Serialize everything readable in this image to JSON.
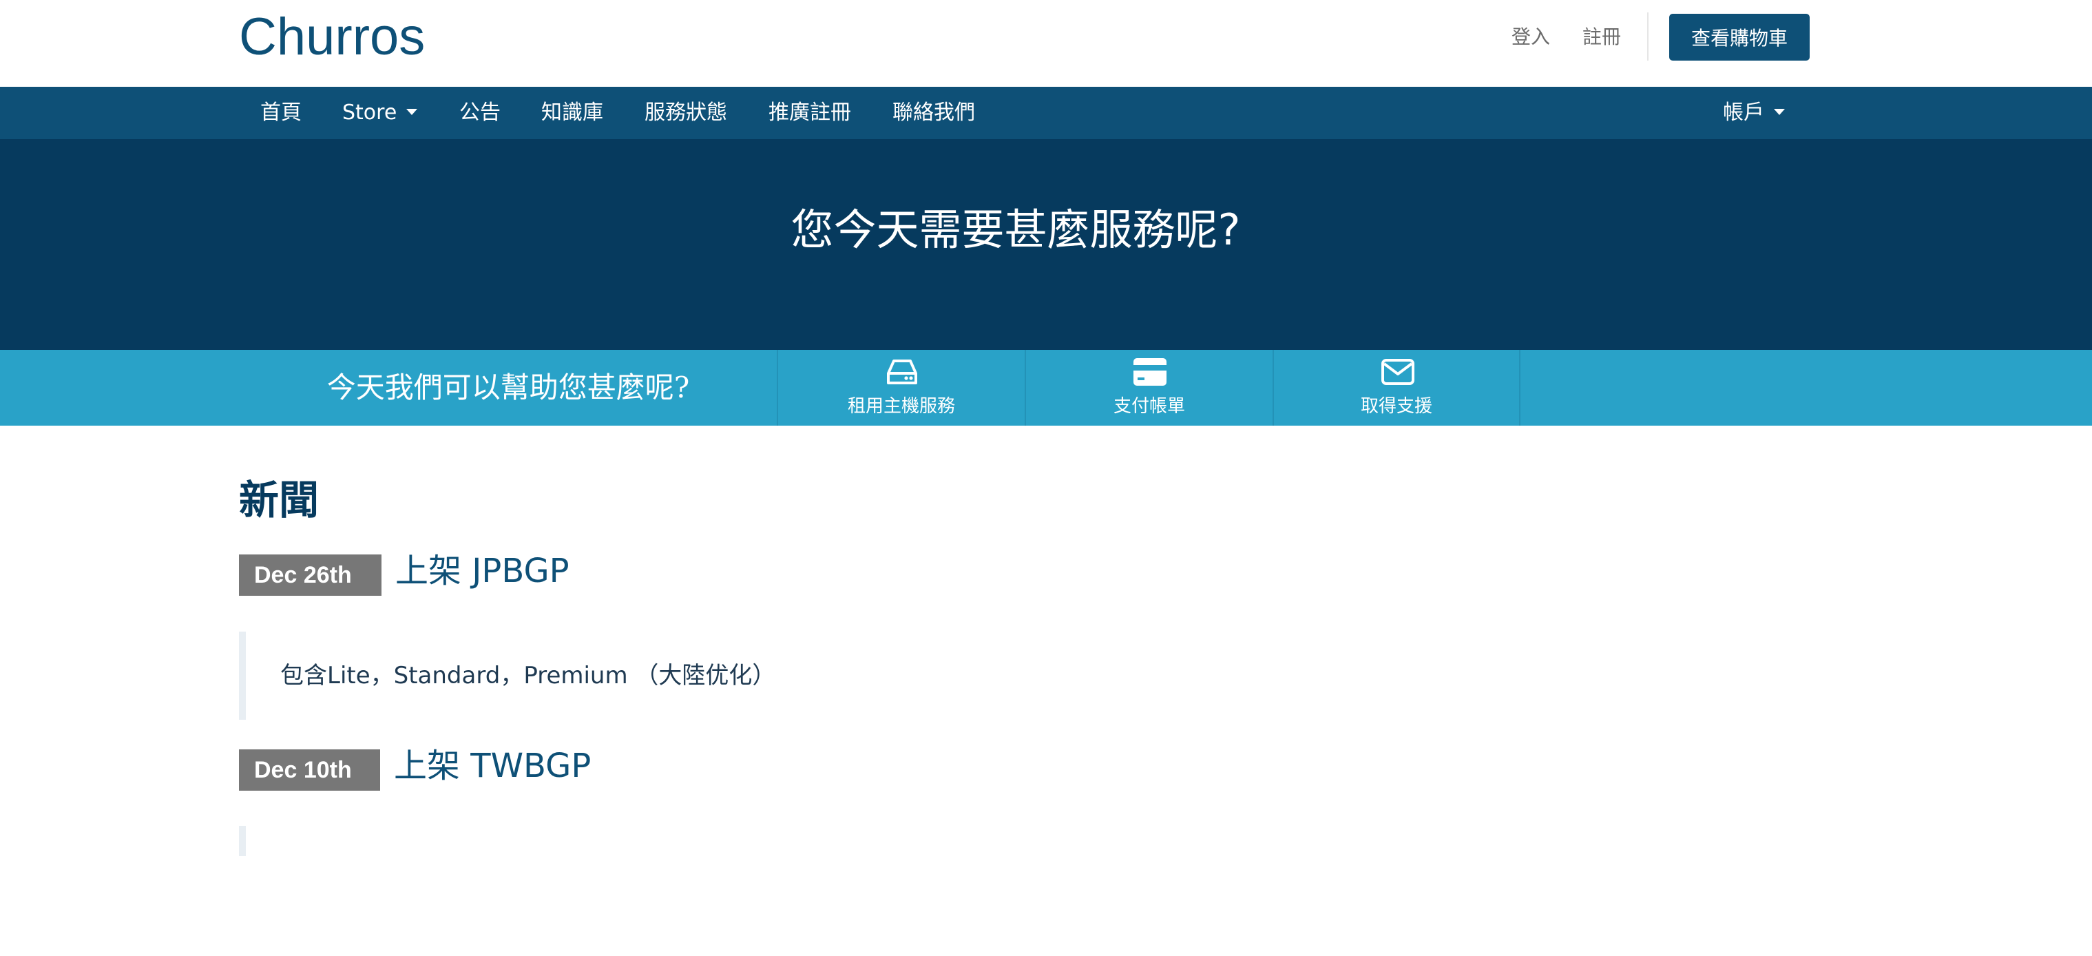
{
  "header": {
    "logo": "Churros",
    "login": "登入",
    "register": "註冊",
    "cart_button": "查看購物車"
  },
  "nav": {
    "items": [
      {
        "label": "首頁"
      },
      {
        "label": "Store"
      },
      {
        "label": "公告"
      },
      {
        "label": "知識庫"
      },
      {
        "label": "服務狀態"
      },
      {
        "label": "推廣註冊"
      },
      {
        "label": "聯絡我們"
      }
    ],
    "account": "帳戶"
  },
  "hero": {
    "title": "您今天需要甚麼服務呢?"
  },
  "help": {
    "text": "今天我們可以幫助您甚麼呢?",
    "items": [
      {
        "label": "租用主機服務",
        "icon": "server-icon"
      },
      {
        "label": "支付帳單",
        "icon": "credit-card-icon"
      },
      {
        "label": "取得支援",
        "icon": "envelope-icon"
      }
    ]
  },
  "news": {
    "title": "新聞",
    "items": [
      {
        "date": "Dec 26th",
        "title": "上架 JPBGP",
        "body": "包含Lite，Standard，Premium （大陸优化）"
      },
      {
        "date": "Dec 10th",
        "title": "上架 TWBGP",
        "body": ""
      }
    ]
  },
  "colors": {
    "brand": "#0e5077",
    "hero": "#063a5e",
    "helpbar": "#29a2c8",
    "badge": "#777777"
  }
}
